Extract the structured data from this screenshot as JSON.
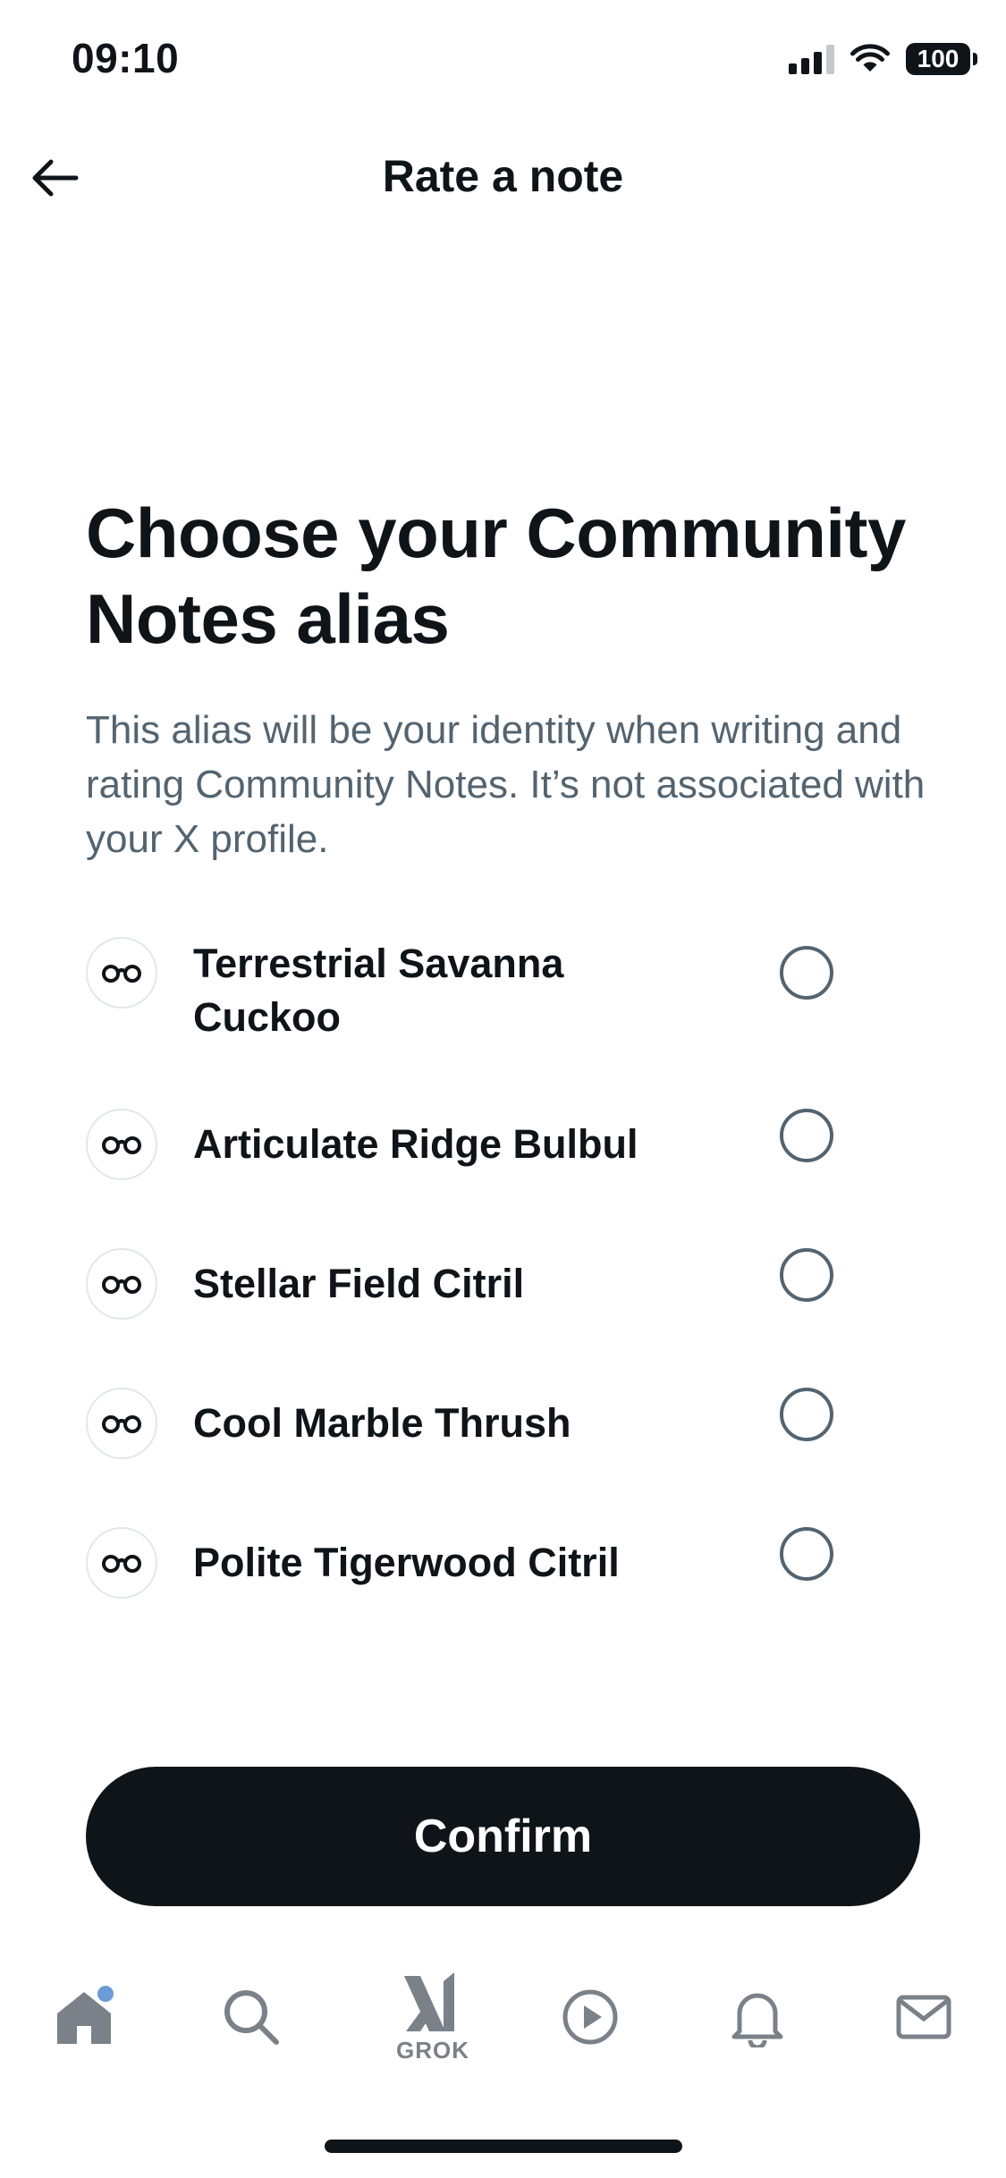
{
  "status_bar": {
    "time": "09:10",
    "battery": "100"
  },
  "header": {
    "title": "Rate a note"
  },
  "main": {
    "title": "Choose your Community Notes alias",
    "description": "This alias will be your identity when writing and rating Community Notes. It’s not associated with your X profile.",
    "aliases": [
      {
        "name": "Terrestrial Savanna Cuckoo",
        "selected": false
      },
      {
        "name": "Articulate Ridge Bulbul",
        "selected": false
      },
      {
        "name": "Stellar Field Citril",
        "selected": false
      },
      {
        "name": "Cool Marble Thrush",
        "selected": false
      },
      {
        "name": "Polite Tigerwood Citril",
        "selected": false
      }
    ],
    "confirm_label": "Confirm"
  },
  "tab_bar": {
    "items": [
      {
        "icon": "home-icon",
        "active": true,
        "has_notification_dot": true
      },
      {
        "icon": "search-icon"
      },
      {
        "icon": "grok-icon",
        "label": "GROK"
      },
      {
        "icon": "play-icon"
      },
      {
        "icon": "bell-icon"
      },
      {
        "icon": "mail-icon"
      }
    ]
  },
  "colors": {
    "text_primary": "#0f1419",
    "text_secondary": "#536471",
    "button_bg": "#0f1419",
    "button_text": "#ffffff",
    "tab_icon": "#7a8189",
    "notification_dot": "#6b9bd8"
  }
}
